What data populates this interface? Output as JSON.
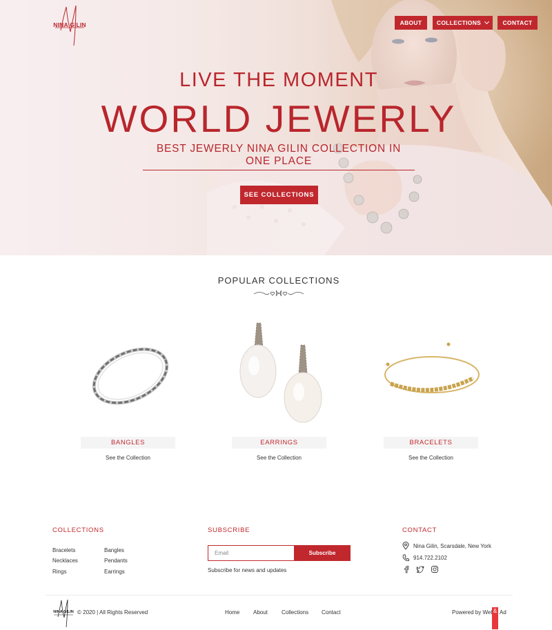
{
  "brand": {
    "logo_text": "NINA GILIN"
  },
  "nav": {
    "about": "ABOUT",
    "collections": "COLLECTIONS",
    "contact": "CONTACT"
  },
  "hero": {
    "subtitle": "LIVE THE MOMENT",
    "title": "WORLD JEWERLY",
    "tagline": "BEST JEWERLY NINA GILIN COLLECTION IN ONE PLACE",
    "cta": "SEE COLLECTIONS"
  },
  "popular": {
    "title": "POPULAR COLLECTIONS",
    "items": [
      {
        "label": "BANGLES",
        "link": "See the Collection",
        "icon": "bangle-image"
      },
      {
        "label": "EARRINGS",
        "link": "See the Collection",
        "icon": "earrings-image"
      },
      {
        "label": "BRACELETS",
        "link": "See the Collection",
        "icon": "bracelet-image"
      }
    ]
  },
  "footer": {
    "collections": {
      "heading": "COLLECTIONS",
      "links": [
        "Bracelets",
        "Bangles",
        "Necklaces",
        "Pendants",
        "Rings",
        "Earrings"
      ]
    },
    "subscribe": {
      "heading": "SUBSCRIBE",
      "placeholder": "Email",
      "button": "Subscribe",
      "note": "Subscribe for news and updates"
    },
    "contact": {
      "heading": "CONTACT",
      "address": "Nina Gilin, Scarsdale, New York",
      "phone": "914.722.2102",
      "social": [
        "facebook-icon",
        "twitter-icon",
        "instagram-icon"
      ]
    },
    "bottom": {
      "logo_text": "NINA GILIN",
      "copyright": "© 2020  |  All Rights Reserved",
      "nav": [
        "Home",
        "About",
        "Collections",
        "Contact"
      ],
      "powered": "Powered by Web",
      "amp": "&",
      "ad": "Ad"
    }
  },
  "colors": {
    "accent": "#c0282e",
    "badge": "#e8373d"
  }
}
